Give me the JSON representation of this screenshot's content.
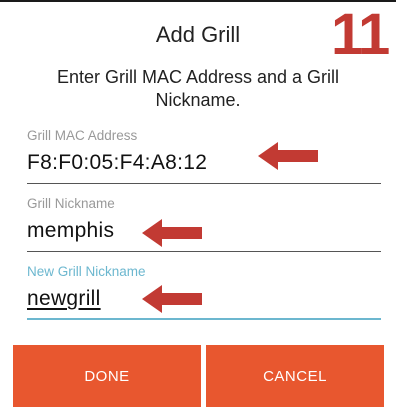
{
  "dialog": {
    "title": "Add Grill",
    "step_number": "11",
    "instructions": "Enter Grill MAC Address and a Grill Nickname."
  },
  "fields": {
    "mac": {
      "label": "Grill MAC Address",
      "value": "F8:F0:05:F4:A8:12"
    },
    "nickname": {
      "label": "Grill Nickname",
      "value": "memphis"
    },
    "new_nickname": {
      "label": "New Grill Nickname",
      "value": "newgrill"
    }
  },
  "buttons": {
    "done": "DONE",
    "cancel": "CANCEL"
  },
  "colors": {
    "accent": "#e8572f",
    "arrow": "#c23a33",
    "focus": "#6cb7cf"
  }
}
